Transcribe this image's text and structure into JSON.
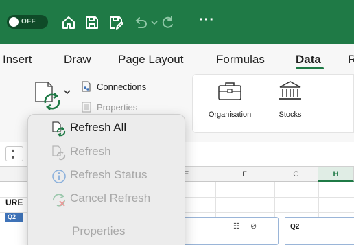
{
  "titlebar": {
    "autosave_label": "OFF",
    "more_label": "···"
  },
  "tabs": [
    {
      "label": "Insert",
      "active": false
    },
    {
      "label": "Draw",
      "active": false
    },
    {
      "label": "Page Layout",
      "active": false
    },
    {
      "label": "Formulas",
      "active": false
    },
    {
      "label": "Data",
      "active": true
    },
    {
      "label": "R",
      "active": false
    }
  ],
  "ribbon": {
    "connections_label": "Connections",
    "properties_label": "Properties",
    "data_types": [
      {
        "label": "Organisation",
        "icon": "briefcase-icon"
      },
      {
        "label": "Stocks",
        "icon": "bank-icon"
      }
    ]
  },
  "grid": {
    "columns": [
      "E",
      "F",
      "G",
      "H"
    ],
    "selected_column": "H",
    "cell_ure": "URE",
    "tag_q2": "Q2",
    "slicer_title": "Q2"
  },
  "refresh_menu": {
    "items": [
      {
        "label": "Refresh All",
        "enabled": true,
        "icon": "refresh-all-icon"
      },
      {
        "label": "Refresh",
        "enabled": false,
        "icon": "refresh-icon"
      },
      {
        "label": "Refresh Status",
        "enabled": false,
        "icon": "info-icon"
      },
      {
        "label": "Cancel Refresh",
        "enabled": false,
        "icon": "cancel-refresh-icon"
      }
    ],
    "properties_label": "Properties"
  },
  "colors": {
    "accent": "#1f7a46",
    "disabled_text": "#a8a8a8",
    "slicer_blue": "#3f73b8"
  }
}
